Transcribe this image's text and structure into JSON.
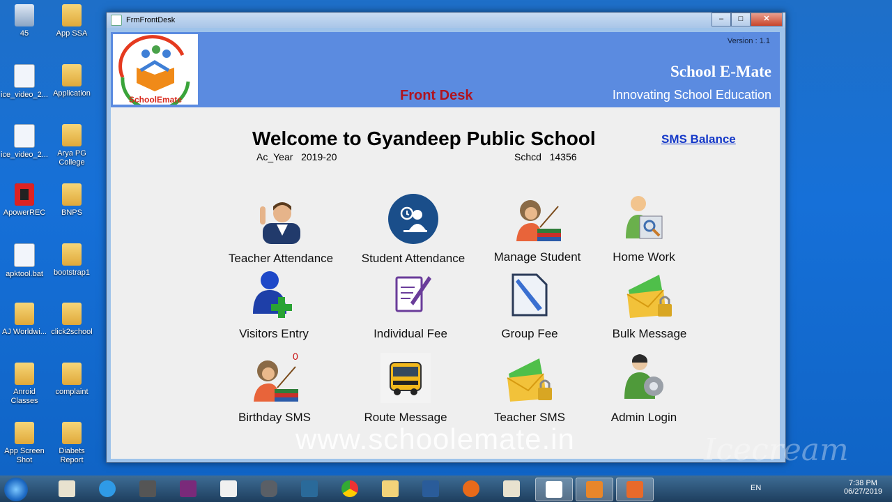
{
  "desktop": {
    "icons": [
      {
        "label": "45",
        "type": "bin"
      },
      {
        "label": "App SSA",
        "type": "folder"
      },
      {
        "label": "ice_video_2...",
        "type": "file"
      },
      {
        "label": "Application",
        "type": "folder"
      },
      {
        "label": "ice_video_2...",
        "type": "file"
      },
      {
        "label": "Arya PG College",
        "type": "folder"
      },
      {
        "label": "ApowerREC",
        "type": "rec"
      },
      {
        "label": "BNPS",
        "type": "folder"
      },
      {
        "label": "apktool.bat",
        "type": "file"
      },
      {
        "label": "bootstrap1",
        "type": "folder"
      },
      {
        "label": "AJ Worldwi...",
        "type": "folder"
      },
      {
        "label": "click2school",
        "type": "folder"
      },
      {
        "label": "Anroid Classes",
        "type": "folder"
      },
      {
        "label": "complaint",
        "type": "folder"
      },
      {
        "label": "App Screen Shot",
        "type": "folder"
      },
      {
        "label": "Diabets Report",
        "type": "folder"
      }
    ]
  },
  "window": {
    "title": "FrmFrontDesk",
    "minimize_label": "‒",
    "maximize_label": "□",
    "close_label": "✕"
  },
  "header": {
    "logo_text": "SchoolEmate",
    "version": "Version : 1.1",
    "brand": "School E-Mate",
    "tagline": "Innovating School Education",
    "section": "Front Desk"
  },
  "main": {
    "welcome": "Welcome to Gyandeep Public School",
    "acyear": "Ac_Year   2019-20",
    "schcd": "Schcd   14356",
    "sms_balance": "SMS Balance",
    "birthday_count": "0",
    "tiles": [
      {
        "label": "Teacher Attendance",
        "icon": "teacher-icon"
      },
      {
        "label": "Student Attendance",
        "icon": "student-attendance-icon"
      },
      {
        "label": "Manage Student",
        "icon": "manage-student-icon"
      },
      {
        "label": "Home Work",
        "icon": "home-work-icon"
      },
      {
        "label": "Visitors Entry",
        "icon": "visitor-add-icon"
      },
      {
        "label": "Individual Fee",
        "icon": "document-edit-icon"
      },
      {
        "label": "Group Fee",
        "icon": "document-pen-icon"
      },
      {
        "label": "Bulk Message",
        "icon": "mail-lock-icon"
      },
      {
        "label": "Birthday SMS",
        "icon": "birthday-icon"
      },
      {
        "label": "Route Message",
        "icon": "bus-icon"
      },
      {
        "label": "Teacher SMS",
        "icon": "mail-lock-icon"
      },
      {
        "label": "Admin Login",
        "icon": "admin-gear-icon"
      }
    ],
    "watermark": "www.schoolemate.in"
  },
  "taskbar": {
    "language": "EN",
    "time": "7:38 PM",
    "date": "06/27/2019"
  },
  "overlay": {
    "recorder": "Icecream"
  }
}
